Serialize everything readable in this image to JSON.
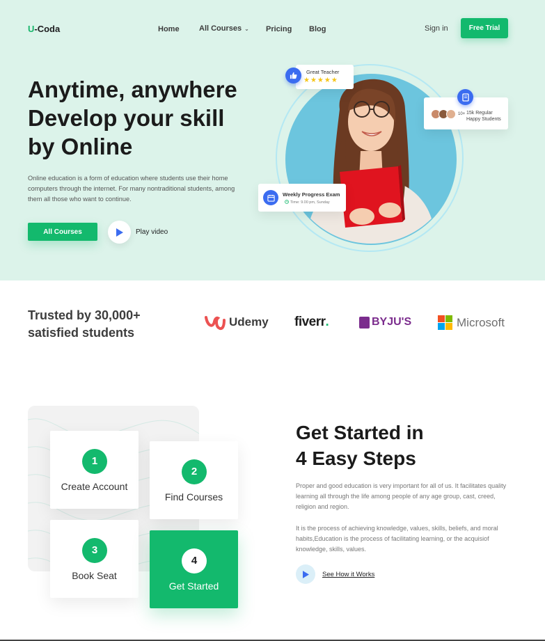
{
  "header": {
    "logo_prefix": "U",
    "logo_rest": "-Coda",
    "nav": [
      {
        "label": "Home"
      },
      {
        "label": "All Courses"
      },
      {
        "label": "Pricing"
      },
      {
        "label": "Blog"
      }
    ],
    "signin": "Sign in",
    "free_trial": "Free Trial"
  },
  "hero": {
    "title_lines": [
      "Anytime, anywhere",
      "Develop your skill",
      "by Online"
    ],
    "description": "Online education is a form of education where students use their home computers through the internet. For many nontraditional students, among them all those who want to continue.",
    "cta": "All Courses",
    "play": "Play video",
    "teacher_card": {
      "title": "Great Teacher",
      "stars": "★★★★★"
    },
    "happy_card": {
      "count": "10+",
      "line1": "15k Regular",
      "line2": "Happy Students"
    },
    "exam_card": {
      "title": "Weekly Progress Exam",
      "time": "Time: 9.00 pm, Sunday"
    }
  },
  "trusted": {
    "line1": "Trusted by 30,000+",
    "line2": "satisfied students",
    "brands": [
      "Udemy",
      "fiverr",
      ".",
      "BYJU'S",
      "Microsoft"
    ]
  },
  "steps": {
    "title_lines": [
      "Get Started in",
      "4 Easy Steps"
    ],
    "items": [
      {
        "num": "1",
        "label": "Create Account"
      },
      {
        "num": "2",
        "label": "Find Courses"
      },
      {
        "num": "3",
        "label": "Book Seat"
      },
      {
        "num": "4",
        "label": "Get Started"
      }
    ],
    "paragraph1": "Proper and good education is very important for all of us. It facilitates quality learning all through the life among people of any age group, cast, creed, religion and region.",
    "paragraph2": "It is the process of achieving knowledge, values, skills, beliefs, and moral habits,Education is the process of facilitating learning, or the acquisiof knowledge, skills, values.",
    "how_link": "See How it Works"
  },
  "colors": {
    "accent": "#13b96d",
    "hero_bg": "#dcf3ea",
    "blue_badge": "#3b6cf0"
  }
}
